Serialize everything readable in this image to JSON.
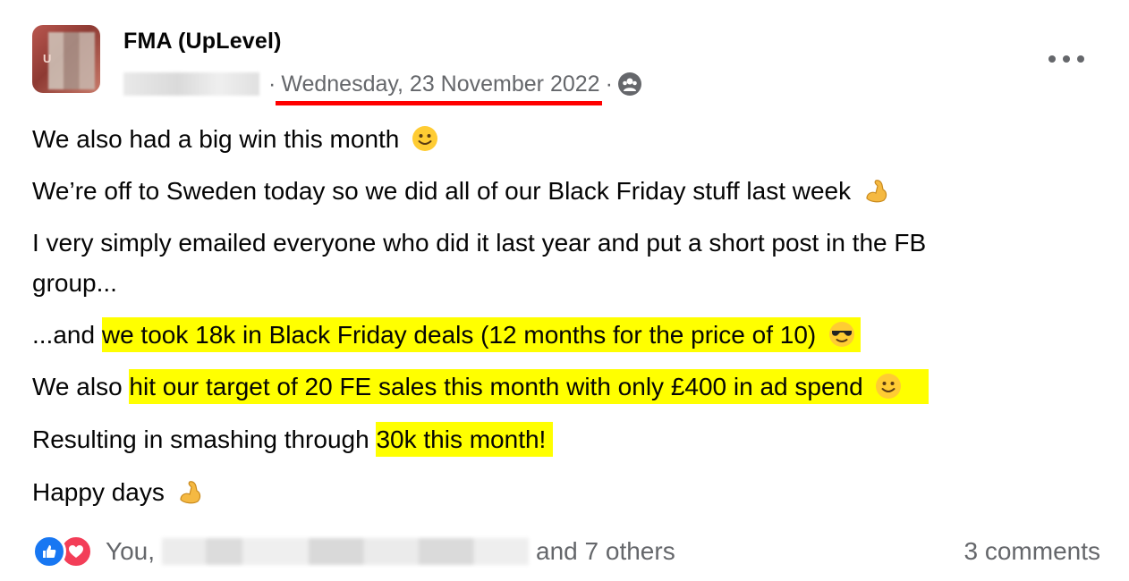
{
  "post": {
    "author": "FMA (UpLevel)",
    "avatar_letter": "U",
    "separator": "·",
    "date": "Wednesday, 23 November 2022",
    "privacy_icon": "group-audience-icon",
    "more_icon": "more-options-icon",
    "lines": {
      "l1": "We also had a big win this month",
      "l2": "We’re off to Sweden today so we did all of our Black Friday stuff last week",
      "l3": "I very simply emailed everyone who did it last year and put a short post in the FB",
      "l4": "group...",
      "l5_pre": "...and ",
      "l5_hl": "we took 18k in Black Friday deals (12 months for the price of 10)",
      "l6_pre": "We also ",
      "l6_hl": "hit our target of 20 FE sales this month with only £400 in ad spend",
      "l7_pre": "Resulting in smashing through ",
      "l7_hl": "30k this month!",
      "l8": "Happy days"
    },
    "emojis": {
      "smile": "slightly-smiling-face-icon",
      "flex": "flexed-biceps-icon",
      "cool": "sunglasses-face-icon"
    }
  },
  "footer": {
    "reactions": [
      "like-icon",
      "love-icon"
    ],
    "reactors_prefix": "You,",
    "reactors_suffix": "and 7 others",
    "comments": "3 comments"
  },
  "colors": {
    "highlight": "#ffff00",
    "date_underline": "#ff0000",
    "secondary_text": "#65676b",
    "like_blue": "#1877f2",
    "love_red": "#f33e58"
  }
}
